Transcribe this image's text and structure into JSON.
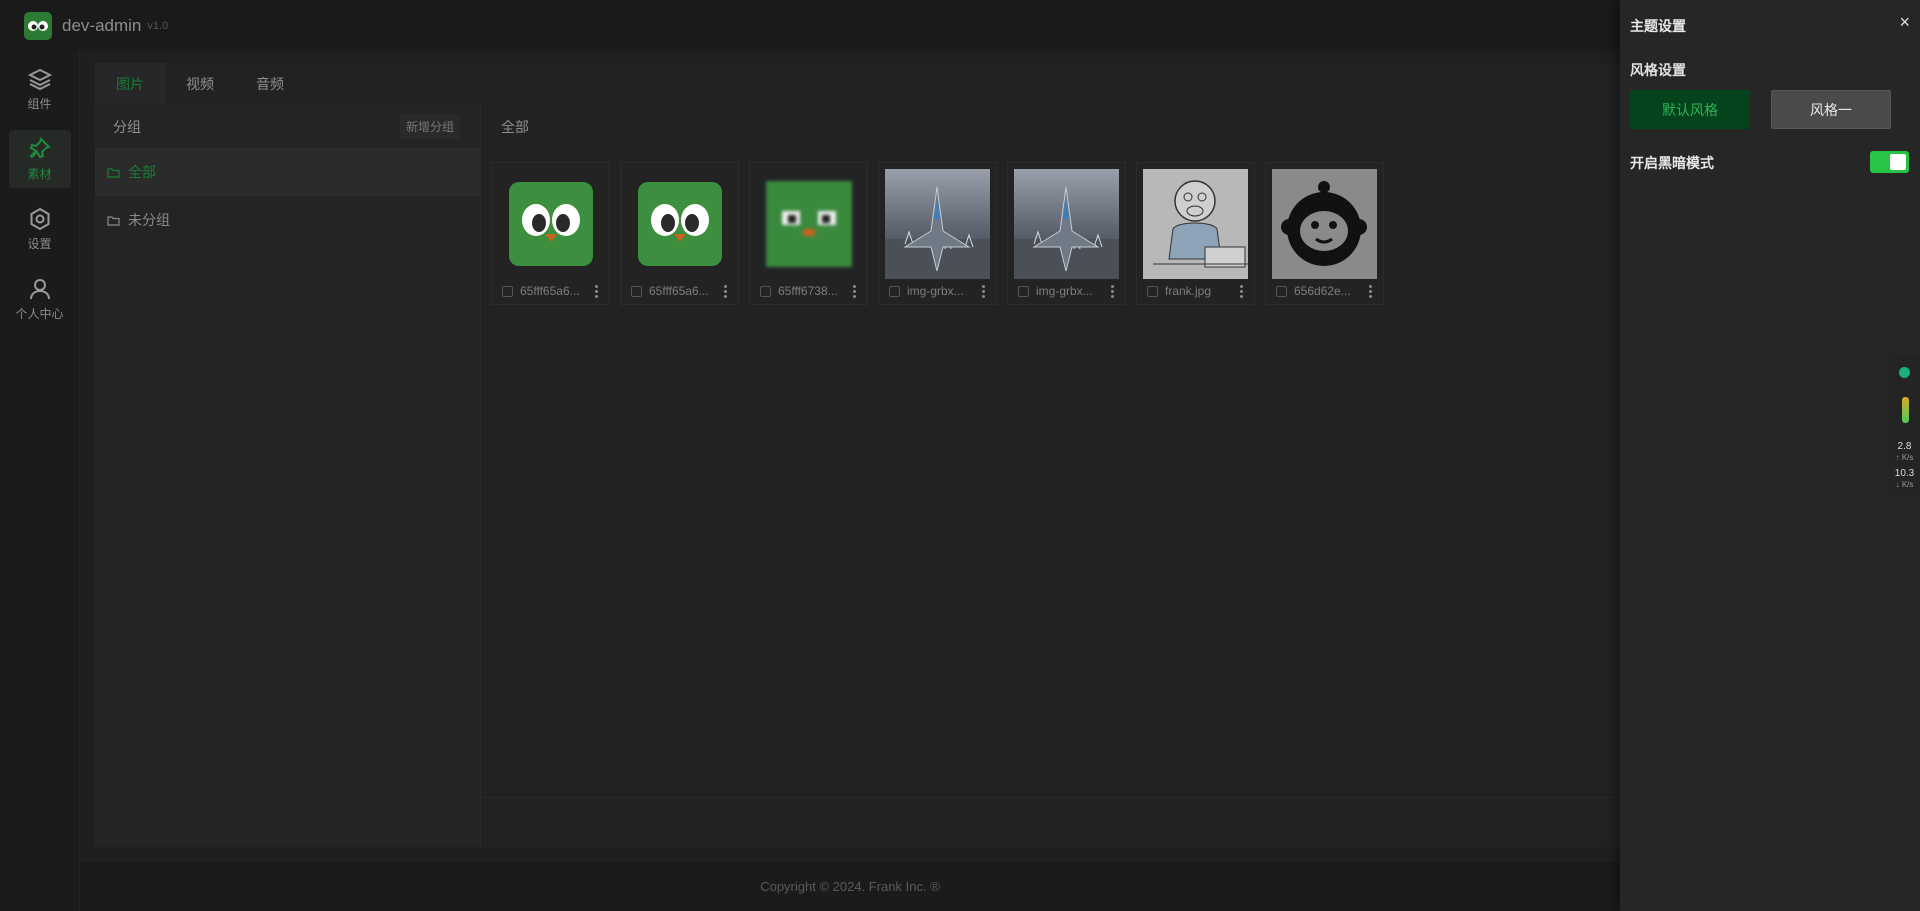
{
  "app": {
    "name": "dev-admin",
    "version": "v1.0"
  },
  "sidebar": {
    "items": [
      {
        "label": "组件",
        "icon": "layers-icon"
      },
      {
        "label": "素材",
        "icon": "pin-icon",
        "active": true
      },
      {
        "label": "设置",
        "icon": "gear-icon"
      },
      {
        "label": "个人中心",
        "icon": "user-icon"
      }
    ]
  },
  "tabs": [
    {
      "label": "图片",
      "active": true
    },
    {
      "label": "视频"
    },
    {
      "label": "音频"
    }
  ],
  "groups": {
    "header": "分组",
    "add_button": "新增分组",
    "items": [
      {
        "label": "全部",
        "active": true
      },
      {
        "label": "未分组"
      }
    ]
  },
  "gallery": {
    "title": "全部",
    "items": [
      {
        "name": "65fff65a6...",
        "kind": "owl"
      },
      {
        "name": "65fff65a6...",
        "kind": "owl"
      },
      {
        "name": "65fff6738...",
        "kind": "owl-blur"
      },
      {
        "name": "img-grbx...",
        "kind": "jet"
      },
      {
        "name": "img-grbx...",
        "kind": "jet"
      },
      {
        "name": "frank.jpg",
        "kind": "monkey-sketch"
      },
      {
        "name": "656d62e...",
        "kind": "monkey-logo"
      }
    ]
  },
  "footer": {
    "copyright": "Copyright © 2024. Frank Inc. ®"
  },
  "drawer": {
    "title": "主题设置",
    "close": "×",
    "style_section": "风格设置",
    "style_default": "默认风格",
    "style_one": "风格一",
    "dark_mode_label": "开启黑暗模式",
    "dark_mode_on": true
  },
  "net_monitor": {
    "up_value": "2.8",
    "up_unit": "↑ K/s",
    "down_value": "10.3",
    "down_unit": "↓ K/s"
  },
  "colors": {
    "accent": "#1a7a30",
    "toggle": "#27c447",
    "bg": "#1d1d1f"
  }
}
